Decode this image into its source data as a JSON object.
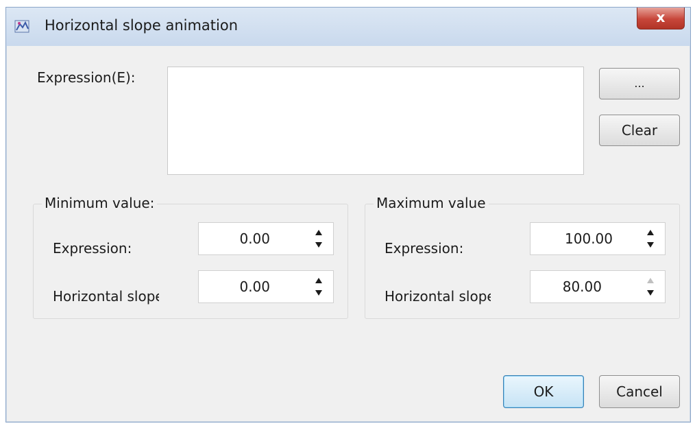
{
  "dialog": {
    "title": "Horizontal slope animation",
    "close_label": "x"
  },
  "expression": {
    "label": "Expression(E):",
    "value": "",
    "browse_label": "...",
    "clear_label": "Clear"
  },
  "minimum": {
    "group_label": "Minimum value:",
    "expression_label": "Expression:",
    "expression_value": "0.00",
    "slope_label": "Horizontal slopе",
    "slope_value": "0.00"
  },
  "maximum": {
    "group_label": "Maximum value",
    "expression_label": "Expression:",
    "expression_value": "100.00",
    "slope_label": "Horizontal slopе",
    "slope_value": "80.00"
  },
  "buttons": {
    "ok_label": "OK",
    "cancel_label": "Cancel"
  }
}
